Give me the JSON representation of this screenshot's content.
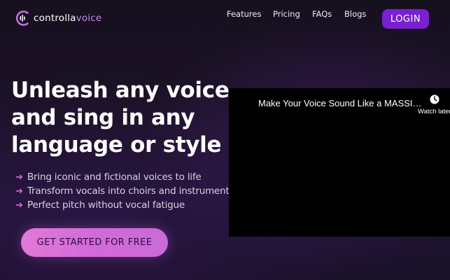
{
  "header": {
    "logo": {
      "text_main": "controlla",
      "text_accent": "voice",
      "icon": "logo-mark-icon"
    },
    "nav": [
      {
        "label": "Features"
      },
      {
        "label": "Pricing"
      },
      {
        "label": "FAQs"
      },
      {
        "label": "Blogs"
      }
    ],
    "login_label": "LOGIN"
  },
  "hero": {
    "title_lines": [
      "Unleash any voice",
      "and sing in any",
      "language or style"
    ],
    "bullets": [
      "Bring iconic and fictional voices to life",
      "Transform vocals into choirs and instruments",
      "Perfect pitch without vocal fatigue"
    ],
    "bullet_icon": "arrow-right-icon",
    "cta_label": "GET STARTED FOR FREE"
  },
  "video": {
    "title": "Make Your Voice Sound Like a MASSI…",
    "watch_later_label": "Watch later",
    "watch_later_icon": "clock-icon"
  },
  "colors": {
    "background": "#1b1226",
    "accent_purple": "#7a1fd1",
    "cta_pink": "#d86ed9",
    "bullet_arrow": "#d76bd8",
    "logo_accent": "#c88df2"
  }
}
